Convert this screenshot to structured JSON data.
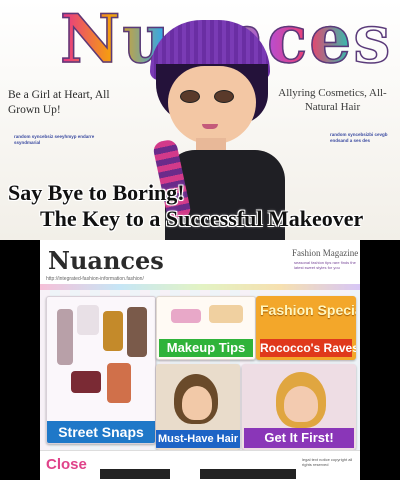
{
  "top_screen": {
    "logo": "Nuances",
    "tagline_left": "Be a Girl at Heart, All Grown Up!",
    "tagline_right": "Allyring Cosmetics, All-Natural Hair",
    "fine_left": "random syncebsiz seeyhmyp endarre ssyndmarial",
    "fine_right": "random syncebsizbi cevgb endsand a ses des",
    "headline_1": "Say Bye to Boring!",
    "headline_2": "The Key to a Successful Makeover"
  },
  "bottom_screen": {
    "logo": "Nuances",
    "subtitle": "Fashion Magazine",
    "fine_header": "seasonal fashion tips rare finds the latest sweet styles for you",
    "url": "http://integrated-fashion-information.fashion/",
    "panels": [
      {
        "id": "street_snaps",
        "label": "Street Snaps"
      },
      {
        "id": "makeup_tips",
        "label": "Makeup Tips"
      },
      {
        "id": "fashion_special",
        "label": "Fashion Special"
      },
      {
        "id": "rococco_raves",
        "label": "Rococco's Raves"
      },
      {
        "id": "must_have_hair",
        "label": "Must-Have Hair"
      },
      {
        "id": "get_it_first",
        "label": "Get It First!"
      }
    ],
    "close_label": "Close",
    "fine_footer": "legal text notice copyright all rights reserved"
  },
  "colors": {
    "street_snaps": "#1f78c8",
    "makeup_tips": "#2fb33a",
    "fashion_special": "#f3a72a",
    "rococco_raves": "#e0391b",
    "must_have_hair": "#1d64c6",
    "get_it_first": "#8a36b8",
    "close": "#e0438a"
  }
}
